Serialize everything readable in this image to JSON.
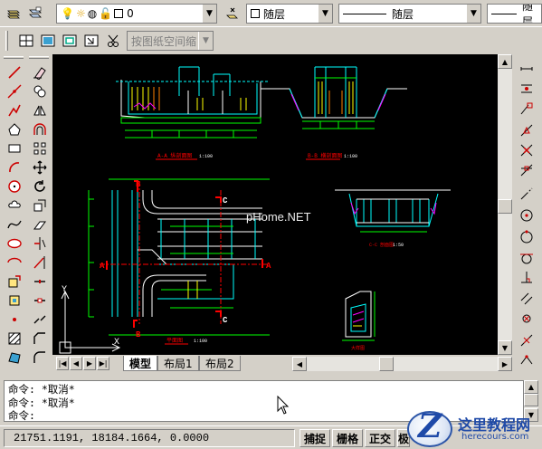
{
  "layer_bar": {
    "layer_value": "0",
    "color_value": "随层",
    "linetype_value": "随层",
    "lineweight_value": "随层",
    "icons": [
      "layer-manager-icon",
      "layer-state-icon",
      "bulb-icon",
      "sun-icon",
      "color-icon",
      "lock-icon",
      "make-current-icon"
    ]
  },
  "viewport_bar": {
    "scale_value": "按图纸空间缩",
    "icons": [
      "single-viewport-icon",
      "viewport-dialog-icon",
      "polygonal-viewport-icon",
      "convert-viewport-icon",
      "clip-viewport-icon"
    ]
  },
  "left_tools": {
    "draw_column": [
      "line-icon",
      "construction-line-icon",
      "polyline-icon",
      "polygon-icon",
      "rectangle-icon",
      "arc-icon",
      "circle-icon",
      "revision-cloud-icon",
      "spline-icon",
      "ellipse-icon",
      "ellipse-arc-icon",
      "insert-block-icon",
      "make-block-icon",
      "point-icon",
      "hatch-icon",
      "region-icon",
      "table-icon",
      "text-icon"
    ],
    "modify_column": [
      "erase-icon",
      "copy-icon",
      "mirror-icon",
      "offset-icon",
      "array-icon",
      "move-icon",
      "rotate-icon",
      "scale-icon",
      "stretch-icon",
      "trim-icon",
      "extend-icon",
      "break-point-icon",
      "break-icon",
      "join-icon",
      "chamfer-icon",
      "fillet-icon",
      "explode-icon"
    ]
  },
  "right_tools": [
    "endpoint-snap-icon",
    "midpoint-snap-icon",
    "intersection-snap-icon",
    "apparent-intersection-icon",
    "extension-snap-icon",
    "center-snap-icon",
    "quadrant-snap-icon",
    "tangent-snap-icon",
    "perpendicular-snap-icon",
    "parallel-snap-icon",
    "insert-snap-icon",
    "node-snap-icon",
    "nearest-snap-icon",
    "none-snap-icon",
    "snap-settings-icon"
  ],
  "drawing": {
    "watermark": "pHome.NET",
    "section_aa_title": "A-A 纵剖面图",
    "section_aa_scale": "1:100",
    "section_bb_title": "B-B 横剖面图",
    "section_bb_scale": "1:100",
    "section_cc_title": "C-C 剖面图",
    "section_cc_scale": "1:50",
    "plan_title": "平面图",
    "plan_scale": "1:100",
    "detail_title": "大样图",
    "markers": [
      "A",
      "A",
      "B",
      "B",
      "C",
      "C"
    ],
    "ucs": {
      "x": "X",
      "y": "Y"
    }
  },
  "tabs": [
    "模型",
    "布局1",
    "布局2"
  ],
  "command": {
    "lines": [
      "命令: *取消*",
      "命令: *取消*",
      "命令:"
    ]
  },
  "status": {
    "coordinates": "21751.1191, 18184.1664, 0.0000",
    "modes": [
      "捕捉",
      "栅格",
      "正交",
      "极"
    ]
  },
  "logo": {
    "title": "这里教程网",
    "url": "herecours.com"
  },
  "colors": {
    "canvas": "#000000",
    "cad_cyan": "#00ffff",
    "cad_yellow": "#ffff00",
    "cad_green": "#00ff00",
    "cad_red": "#ff0000",
    "cad_white": "#ffffff",
    "cad_magenta": "#ff00ff",
    "cad_orange": "#ff8000"
  }
}
